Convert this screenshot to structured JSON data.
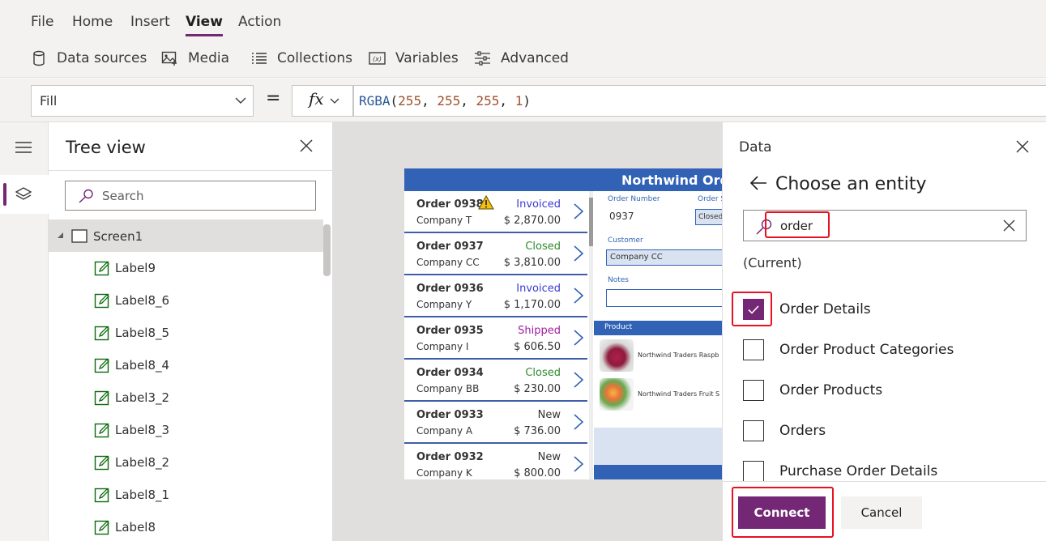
{
  "menubar": {
    "items": [
      "File",
      "Home",
      "Insert",
      "View",
      "Action"
    ],
    "active": "View"
  },
  "toolbar": {
    "data_sources": "Data sources",
    "media": "Media",
    "collections": "Collections",
    "variables": "Variables",
    "advanced": "Advanced"
  },
  "formula_bar": {
    "property": "Fill",
    "equals": "=",
    "fx": "fx",
    "formula": {
      "fn": "RGBA",
      "open": "(",
      "r": "255",
      "g": "255",
      "b": "255",
      "a": "1",
      "close": ")",
      "sep": ", "
    }
  },
  "tree_view": {
    "title": "Tree view",
    "search_placeholder": "Search",
    "screen": "Screen1",
    "items": [
      "Label9",
      "Label8_6",
      "Label8_5",
      "Label8_4",
      "Label3_2",
      "Label8_3",
      "Label8_2",
      "Label8_1",
      "Label8"
    ]
  },
  "app": {
    "title": "Northwind Ord",
    "orders": [
      {
        "number": "Order 0938",
        "company": "Company T",
        "status": "Invoiced",
        "amount": "$ 2,870.00",
        "warning": true
      },
      {
        "number": "Order 0937",
        "company": "Company CC",
        "status": "Closed",
        "amount": "$ 3,810.00",
        "warning": false
      },
      {
        "number": "Order 0936",
        "company": "Company Y",
        "status": "Invoiced",
        "amount": "$ 1,170.00",
        "warning": false
      },
      {
        "number": "Order 0935",
        "company": "Company I",
        "status": "Shipped",
        "amount": "$ 606.50",
        "warning": false
      },
      {
        "number": "Order 0934",
        "company": "Company BB",
        "status": "Closed",
        "amount": "$ 230.00",
        "warning": false
      },
      {
        "number": "Order 0933",
        "company": "Company A",
        "status": "New",
        "amount": "$ 736.00",
        "warning": false
      },
      {
        "number": "Order 0932",
        "company": "Company K",
        "status": "New",
        "amount": "$ 800.00",
        "warning": false
      }
    ],
    "status_colors": {
      "Invoiced": "#3b3bd1",
      "Closed": "#2e8b2e",
      "Shipped": "#a020a0",
      "New": "#333333"
    },
    "detail": {
      "order_number_label": "Order Number",
      "order_number": "0937",
      "order_status_label": "Order S",
      "order_status": "Closed",
      "customer_label": "Customer",
      "customer": "Company CC",
      "notes_label": "Notes",
      "product_label": "Product",
      "products": [
        "Northwind Traders Raspb",
        "Northwind Traders Fruit S"
      ]
    }
  },
  "data_pane": {
    "title": "Data",
    "subtitle": "Choose an entity",
    "search_value": "order",
    "current": "(Current)",
    "entities": [
      {
        "name": "Order Details",
        "checked": true
      },
      {
        "name": "Order Product Categories",
        "checked": false
      },
      {
        "name": "Order Products",
        "checked": false
      },
      {
        "name": "Orders",
        "checked": false
      },
      {
        "name": "Purchase Order Details",
        "checked": false
      }
    ],
    "connect": "Connect",
    "cancel": "Cancel"
  },
  "colors": {
    "accent": "#742774",
    "app_header": "#3162b6",
    "highlight": "#e81123"
  }
}
